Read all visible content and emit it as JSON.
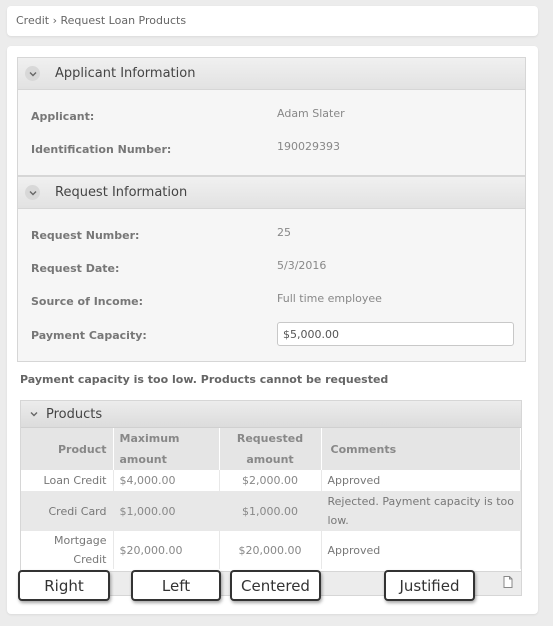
{
  "breadcrumb": {
    "root": "Credit",
    "separator": "›",
    "current": "Request Loan Products"
  },
  "applicant_section": {
    "title": "Applicant Information",
    "fields": [
      {
        "label": "Applicant:",
        "value": "Adam Slater"
      },
      {
        "label": "Identification Number:",
        "value": "190029393"
      }
    ]
  },
  "request_section": {
    "title": "Request Information",
    "fields": [
      {
        "label": "Request Number:",
        "value": "25"
      },
      {
        "label": "Request Date:",
        "value": "5/3/2016"
      },
      {
        "label": "Source of Income:",
        "value": "Full time employee"
      }
    ],
    "payment_label": "Payment Capacity:",
    "payment_value": "$5,000.00"
  },
  "warning": "Payment capacity is too low. Products cannot be requested",
  "products": {
    "title": "Products",
    "columns": {
      "product": "Product",
      "max_line1": "Maximum",
      "max_line2": "amount",
      "req_line1": "Requested",
      "req_line2": "amount",
      "comments": "Comments"
    },
    "rows": [
      {
        "product": "Loan Credit",
        "max": "$4,000.00",
        "requested": "$2,000.00",
        "comments": "Approved"
      },
      {
        "product": "Credi Card",
        "max": "$1,000.00",
        "requested": "$1,000.00",
        "comments": "Rejected. Payment capacity is too low."
      },
      {
        "product_line1": "Mortgage",
        "product_line2": "Credit",
        "max": "$20,000.00",
        "requested": "$20,000.00",
        "comments": "Approved"
      }
    ]
  },
  "alignment_labels": {
    "right": "Right",
    "left": "Left",
    "centered": "Centered",
    "justified": "Justified"
  },
  "colors": {
    "panel_bg": "#ffffff",
    "page_bg": "#ececec",
    "header_gradient_top": "#f0f0f0",
    "header_gradient_bottom": "#e2e2e2"
  }
}
